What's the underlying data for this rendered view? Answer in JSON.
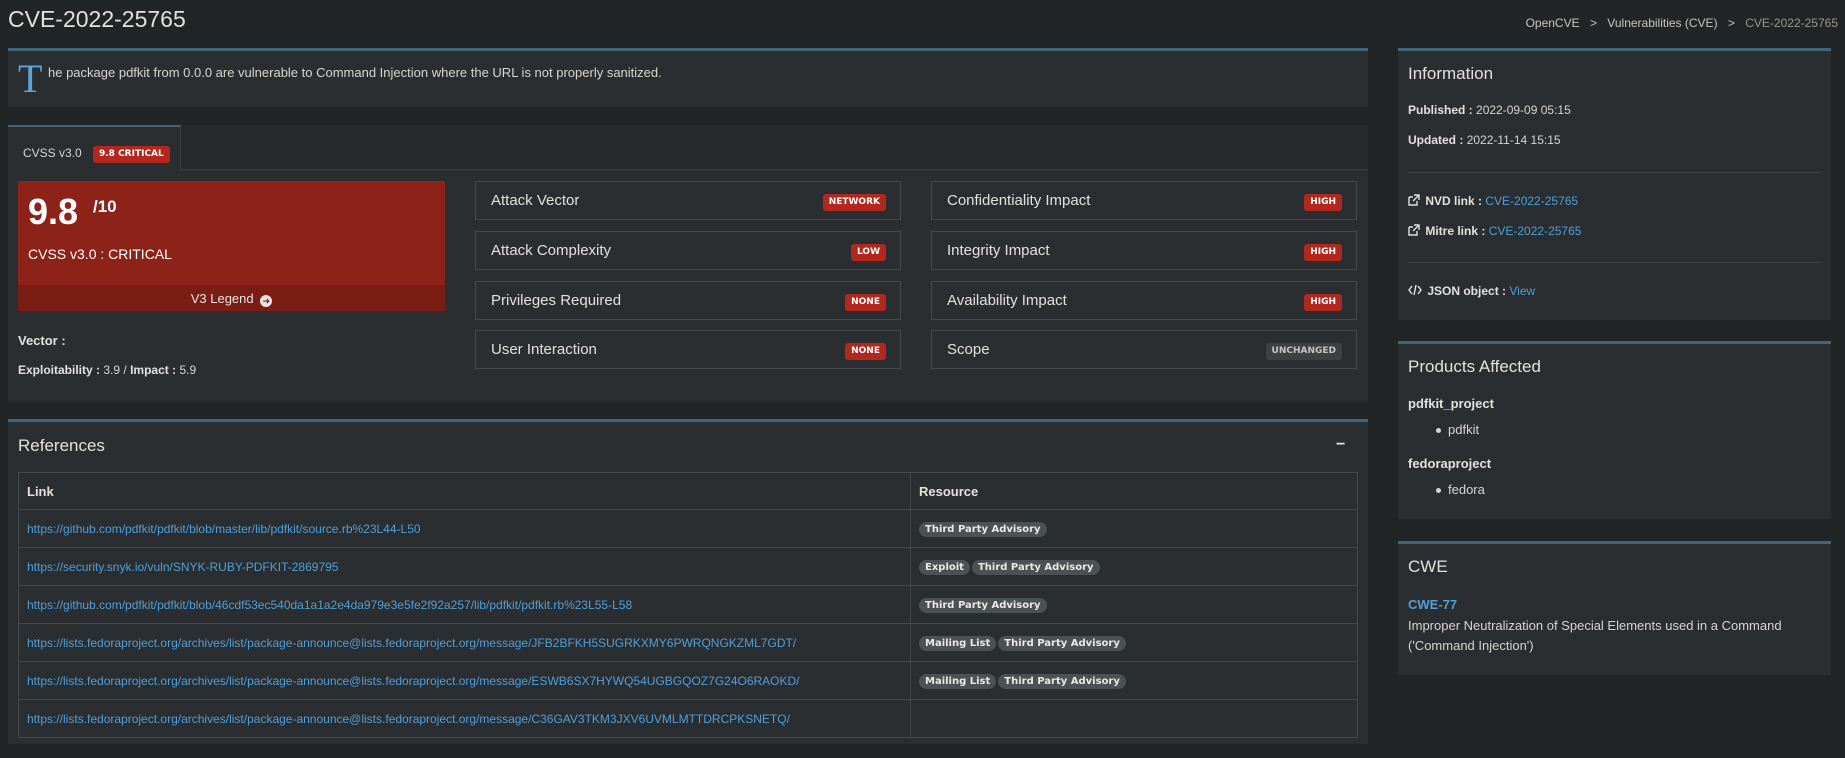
{
  "header": {
    "title": "CVE-2022-25765",
    "breadcrumb": [
      "OpenCVE",
      "Vulnerabilities (CVE)",
      "CVE-2022-25765"
    ],
    "separator": ">"
  },
  "description": {
    "drop_cap": "T",
    "text": "he package pdfkit from 0.0.0 are vulnerable to Command Injection where the URL is not properly sanitized."
  },
  "cvss": {
    "tab_label": "CVSS v3.0",
    "tab_badge": "9.8 CRITICAL",
    "score": "9.8",
    "max": "/10",
    "severity_line": "CVSS v3.0 : CRITICAL",
    "legend_label": "V3 Legend",
    "vector_label": "Vector :",
    "exploitability_label": "Exploitability :",
    "exploitability_value": "3.9",
    "slash": "/",
    "impact_label": "Impact :",
    "impact_value": "5.9",
    "metrics_left": [
      {
        "name": "Attack Vector",
        "value": "NETWORK"
      },
      {
        "name": "Attack Complexity",
        "value": "LOW"
      },
      {
        "name": "Privileges Required",
        "value": "NONE"
      },
      {
        "name": "User Interaction",
        "value": "NONE"
      }
    ],
    "metrics_right": [
      {
        "name": "Confidentiality Impact",
        "value": "HIGH"
      },
      {
        "name": "Integrity Impact",
        "value": "HIGH"
      },
      {
        "name": "Availability Impact",
        "value": "HIGH"
      },
      {
        "name": "Scope",
        "value": "UNCHANGED"
      }
    ]
  },
  "references": {
    "title": "References",
    "collapse_symbol": "−",
    "columns": [
      "Link",
      "Resource"
    ],
    "rows": [
      {
        "link": "https://github.com/pdfkit/pdfkit/blob/master/lib/pdfkit/source.rb%23L44-L50",
        "tags": [
          "Third Party Advisory"
        ]
      },
      {
        "link": "https://security.snyk.io/vuln/SNYK-RUBY-PDFKIT-2869795",
        "tags": [
          "Exploit",
          "Third Party Advisory"
        ]
      },
      {
        "link": "https://github.com/pdfkit/pdfkit/blob/46cdf53ec540da1a1a2e4da979e3e5fe2f92a257/lib/pdfkit/pdfkit.rb%23L55-L58",
        "tags": [
          "Third Party Advisory"
        ]
      },
      {
        "link": "https://lists.fedoraproject.org/archives/list/package-announce@lists.fedoraproject.org/message/JFB2BFKH5SUGRKXMY6PWRQNGKZML7GDT/",
        "tags": [
          "Mailing List",
          "Third Party Advisory"
        ]
      },
      {
        "link": "https://lists.fedoraproject.org/archives/list/package-announce@lists.fedoraproject.org/message/ESWB6SX7HYWQ54UGBGQOZ7G24O6RAOKD/",
        "tags": [
          "Mailing List",
          "Third Party Advisory"
        ]
      },
      {
        "link": "https://lists.fedoraproject.org/archives/list/package-announce@lists.fedoraproject.org/message/C36GAV3TKM3JXV6UVMLMTTDRCPKSNETQ/",
        "tags": []
      }
    ]
  },
  "information": {
    "title": "Information",
    "published_label": "Published :",
    "published_value": "2022-09-09 05:15",
    "updated_label": "Updated :",
    "updated_value": "2022-11-14 15:15",
    "nvd_label": "NVD link :",
    "nvd_value": "CVE-2022-25765",
    "mitre_label": "Mitre link :",
    "mitre_value": "CVE-2022-25765",
    "json_label": "JSON object :",
    "json_value": "View"
  },
  "products": {
    "title": "Products Affected",
    "vendors": [
      {
        "name": "pdfkit_project",
        "products": [
          "pdfkit"
        ]
      },
      {
        "name": "fedoraproject",
        "products": [
          "fedora"
        ]
      }
    ]
  },
  "cwe": {
    "title": "CWE",
    "id": "CWE-77",
    "description": "Improper Neutralization of Special Elements used in a Command ('Command Injection')"
  },
  "colors": {
    "background": "#222526",
    "panel": "#2a2e30",
    "accent_border": "#40657e",
    "critical": "#8d2219",
    "badge_red": "#b3281e",
    "link": "#4f9fd9"
  }
}
